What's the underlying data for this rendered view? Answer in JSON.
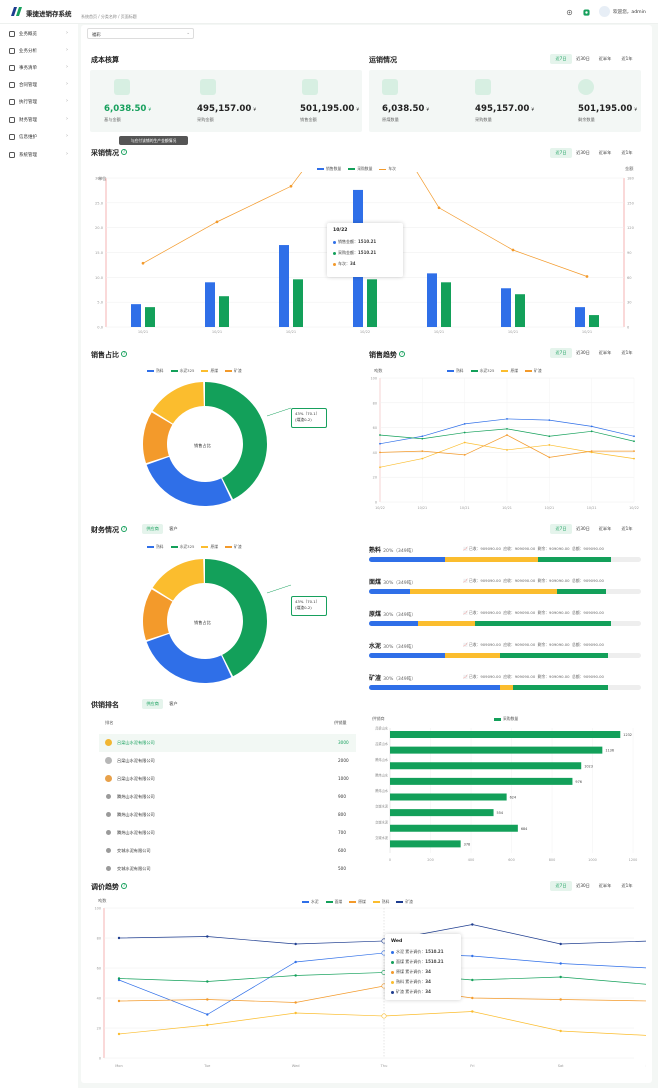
{
  "app": {
    "brand": "秉捷进销存系统",
    "breadcrumb": "系统首页  /  分类名称  /  页面标题",
    "user": "欢迎您，admin"
  },
  "sidebar": {
    "items": [
      {
        "label": "业务概览"
      },
      {
        "label": "业务分析"
      },
      {
        "label": "事务清单"
      },
      {
        "label": "合同管理"
      },
      {
        "label": "执行管理"
      },
      {
        "label": "财务管理"
      },
      {
        "label": "信息维护"
      },
      {
        "label": "系统管理"
      }
    ]
  },
  "filter": {
    "value": "福彩"
  },
  "cost": {
    "title": "成本核算",
    "items": [
      {
        "value": "6,038.50",
        "unit": "¥",
        "label": "基与金额"
      },
      {
        "value": "495,157.00",
        "unit": "¥",
        "label": "采购金额"
      },
      {
        "value": "501,195.00",
        "unit": "¥",
        "label": "销售金额"
      }
    ]
  },
  "ops": {
    "title": "运销情况",
    "tabs": [
      "近7日",
      "近30日",
      "近半年",
      "近1年"
    ],
    "items": [
      {
        "value": "6,038.50",
        "unit": "¥",
        "label": "原煤数量"
      },
      {
        "value": "495,157.00",
        "unit": "¥",
        "label": "采购数量"
      },
      {
        "value": "501,195.00",
        "unit": "¥",
        "label": "剩余数量"
      }
    ]
  },
  "purchase": {
    "title": "采销情况",
    "hint": "与应付该铺的生产金额情况",
    "tabs": [
      "近7日",
      "近30日",
      "近半年",
      "近1年"
    ],
    "legend": [
      "销售数量",
      "采购数量",
      "车次"
    ],
    "left_unit": "单位",
    "right_unit": "金额",
    "tooltip": {
      "date": "10/22",
      "rows": [
        {
          "label": "销售金额：",
          "value": "1510.21"
        },
        {
          "label": "采购金额：",
          "value": "1510.21"
        },
        {
          "label": "车次：",
          "value": "34"
        }
      ]
    }
  },
  "sales_share": {
    "title": "销售占比",
    "legend": [
      "熟料",
      "水泥325",
      "原煤",
      "矿渣"
    ],
    "center": "销售占比",
    "callout": [
      "43%（70.1）",
      "(煤渣0-2)"
    ]
  },
  "sales_trend": {
    "title": "销售趋势",
    "tabs": [
      "近7日",
      "近30日",
      "近半年",
      "近1年"
    ],
    "legend": [
      "熟料",
      "水泥325",
      "原煤",
      "矿渣"
    ],
    "yunit": "吨数"
  },
  "finance": {
    "title": "财务情况",
    "tabs": [
      "供应商",
      "客户"
    ],
    "legend": [
      "熟料",
      "水泥325",
      "原煤",
      "矿渣"
    ],
    "center": "销售占比",
    "callout": [
      "43%（70.1）",
      "(煤渣0-2)"
    ]
  },
  "finance_bars": {
    "tabs": [
      "近7日",
      "近30日",
      "近半年",
      "近1年"
    ],
    "rows": [
      {
        "name": "熟料",
        "pct": "20%（349吨）",
        "s1": "已收：909090.00",
        "s2": "应收：909090.00",
        "s3": "剩余：909090.00",
        "s4": "总额：909090.00"
      },
      {
        "name": "面煤",
        "pct": "30%（349吨）",
        "s1": "已收：909090.00",
        "s2": "应收：909090.00",
        "s3": "剩余：909090.00",
        "s4": "总额：909090.00"
      },
      {
        "name": "原煤",
        "pct": "30%（349吨）",
        "s1": "已收：909090.00",
        "s2": "应收：909090.00",
        "s3": "剩余：909090.00",
        "s4": "总额：909090.00"
      },
      {
        "name": "水泥",
        "pct": "30%（349吨）",
        "s1": "已收：909090.00",
        "s2": "应收：909090.00",
        "s3": "剩余：909090.00",
        "s4": "总额：909090.00"
      },
      {
        "name": "矿渣",
        "pct": "30%（349吨）",
        "s1": "已收：909090.00",
        "s2": "应收：909090.00",
        "s3": "剩余：909090.00",
        "s4": "总额：909090.00"
      }
    ]
  },
  "ranking": {
    "title": "供销排名",
    "tabs": [
      "供应商",
      "客户"
    ],
    "head": [
      "排名",
      "供销量"
    ],
    "rows": [
      {
        "name": "吕梁山水泥有限公司",
        "value": "3000"
      },
      {
        "name": "吕梁山水泥有限公司",
        "value": "2000"
      },
      {
        "name": "吕梁山水泥有限公司",
        "value": "1000"
      },
      {
        "name": "腾炜山水泥有限公司",
        "value": "900"
      },
      {
        "name": "腾炜山水泥有限公司",
        "value": "800"
      },
      {
        "name": "腾炜山水泥有限公司",
        "value": "700"
      },
      {
        "name": "交城水泥有限公司",
        "value": "600"
      },
      {
        "name": "交城水泥有限公司",
        "value": "500"
      }
    ],
    "hbar": {
      "yunit": "供销商",
      "legend": "采购数量",
      "cats": [
        "吕梁山水",
        "吕梁山水",
        "腾炜山水",
        "腾炜山水",
        "腾炜山水",
        "交城水泥",
        "交城水泥",
        "交城水泥"
      ],
      "values": [
        1232,
        1136,
        1023,
        976,
        624,
        554,
        684,
        378
      ],
      "ticks": [
        "0",
        "200",
        "400",
        "600",
        "800",
        "1000",
        "1200"
      ]
    }
  },
  "price": {
    "title": "调价趋势",
    "tabs": [
      "近7日",
      "近30日",
      "近半年",
      "近1年"
    ],
    "legend": [
      "水泥",
      "面煤",
      "原煤",
      "熟料",
      "矿渣"
    ],
    "yunit": "吨数",
    "tooltip": {
      "day": "Wed",
      "rows": [
        {
          "label": "水泥 累计调价：",
          "value": "1510.21"
        },
        {
          "label": "面煤 累计调价：",
          "value": "1510.21"
        },
        {
          "label": "原煤 累计调价：",
          "value": "34"
        },
        {
          "label": "熟料 累计调价：",
          "value": "34"
        },
        {
          "label": "矿渣 累计调价：",
          "value": "34"
        }
      ]
    }
  },
  "chart_data": [
    {
      "type": "bar",
      "title": "采销情况",
      "categories": [
        "10/21",
        "10/21",
        "10/21",
        "10/22",
        "10/21",
        "10/21",
        "10/21"
      ],
      "series": [
        {
          "name": "销售数量",
          "values": [
            4.6,
            9,
            16.5,
            27.6,
            10.8,
            7.8,
            4
          ]
        },
        {
          "name": "采购数量",
          "values": [
            4,
            6.2,
            9.6,
            9.6,
            9,
            6.6,
            2.4
          ]
        },
        {
          "name": "车次",
          "values": [
            77,
            127,
            170,
            289,
            144,
            93,
            61
          ]
        }
      ],
      "yticks": [
        "0.0",
        "5.0",
        "10.0",
        "15.0",
        "20.0",
        "25.0",
        "30.0"
      ],
      "y2ticks": [
        "0",
        "30",
        "60",
        "90",
        "120",
        "150",
        "180"
      ]
    },
    {
      "type": "pie",
      "title": "销售占比",
      "categories": [
        "熟料",
        "水泥325",
        "原煤",
        "矿渣"
      ],
      "values": [
        43,
        27,
        16,
        14
      ]
    },
    {
      "type": "line",
      "title": "销售趋势",
      "categories": [
        "10/22",
        "10/21",
        "10/21",
        "10/21",
        "10/21",
        "10/21",
        "10/22"
      ],
      "series": [
        {
          "name": "熟料",
          "values": [
            47,
            53,
            63,
            67,
            66,
            61,
            53
          ]
        },
        {
          "name": "水泥325",
          "values": [
            54,
            51,
            56,
            59,
            53,
            57,
            49
          ]
        },
        {
          "name": "原煤",
          "values": [
            28,
            35,
            48,
            42,
            46,
            40,
            35
          ]
        },
        {
          "name": "矿渣",
          "values": [
            40,
            41,
            38,
            54,
            36,
            41,
            41
          ]
        }
      ],
      "yticks": [
        "0",
        "20",
        "40",
        "60",
        "80",
        "100"
      ]
    },
    {
      "type": "pie",
      "title": "财务情况",
      "categories": [
        "熟料",
        "水泥325",
        "原煤",
        "矿渣"
      ],
      "values": [
        43,
        27,
        16,
        14
      ]
    },
    {
      "type": "bar",
      "title": "财务情况进度",
      "categories": [
        "熟料",
        "面煤",
        "原煤",
        "水泥",
        "矿渣"
      ],
      "series": [
        {
          "name": "已收",
          "values": [
            28,
            15,
            18,
            28,
            48
          ]
        },
        {
          "name": "应收",
          "values": [
            34,
            54,
            21,
            20,
            5
          ]
        },
        {
          "name": "剩余",
          "values": [
            27,
            18,
            50,
            40,
            35
          ]
        }
      ]
    },
    {
      "type": "line",
      "title": "调价趋势",
      "categories": [
        "Mon",
        "Tue",
        "Wed",
        "Thu",
        "Fri",
        "Sat",
        "Sun"
      ],
      "series": [
        {
          "name": "水泥",
          "values": [
            80,
            81,
            76,
            78,
            89,
            76,
            78
          ]
        },
        {
          "name": "面煤",
          "values": [
            52,
            29,
            64,
            70,
            68,
            63,
            60
          ]
        },
        {
          "name": "原煤",
          "values": [
            53,
            51,
            55,
            57,
            52,
            54,
            49
          ]
        },
        {
          "name": "熟料",
          "values": [
            38,
            39,
            37,
            48,
            40,
            39,
            38
          ]
        },
        {
          "name": "矿渣",
          "values": [
            16,
            22,
            30,
            28,
            31,
            18,
            15
          ]
        }
      ],
      "yticks": [
        "0",
        "20",
        "40",
        "60",
        "80",
        "100"
      ]
    }
  ]
}
